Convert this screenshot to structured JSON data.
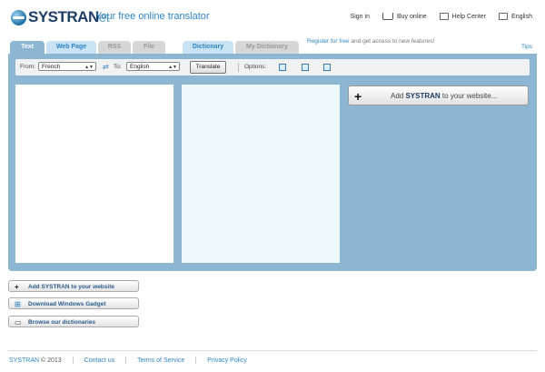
{
  "header": {
    "logo_main": "SYSTRAN",
    "logo_sub": "et",
    "tagline": "Your free online translator",
    "sign_in": "Sign in",
    "buy_online": "Buy online",
    "help_center": "Help Center",
    "language": "English"
  },
  "tabs": [
    {
      "label": "Text"
    },
    {
      "label": "Web Page"
    },
    {
      "label": "RSS"
    },
    {
      "label": "File"
    },
    {
      "label": "Dictionary"
    },
    {
      "label": "My Dictionary"
    }
  ],
  "register": {
    "link": "Register for free",
    "rest": " and get access to new features!"
  },
  "tips": "Tips",
  "toolbar": {
    "from_label": "From:",
    "from_value": "French",
    "to_label": "To:",
    "to_value": "English",
    "translate_label": "Translate",
    "options_label": "Options:"
  },
  "panel": {
    "add_button_prefix": "Add ",
    "add_button_brand": "SYSTRAN",
    "add_button_suffix": " to your website..."
  },
  "side_buttons": [
    {
      "label": "Add SYSTRAN to your website",
      "icon": "plus-icon"
    },
    {
      "label": "Download Windows Gadget",
      "icon": "windows-icon"
    },
    {
      "label": "Browse our dictionaries",
      "icon": "book-icon"
    }
  ],
  "footer": {
    "brand": "SYSTRAN",
    "copyright": " © 2013",
    "contact": "Contact us",
    "terms": "Terms of Service",
    "privacy": "Privacy Policy"
  },
  "colors": {
    "panel": "#8cb6d1",
    "accent": "#2f84c4",
    "target_bg": "#eef9fc"
  }
}
